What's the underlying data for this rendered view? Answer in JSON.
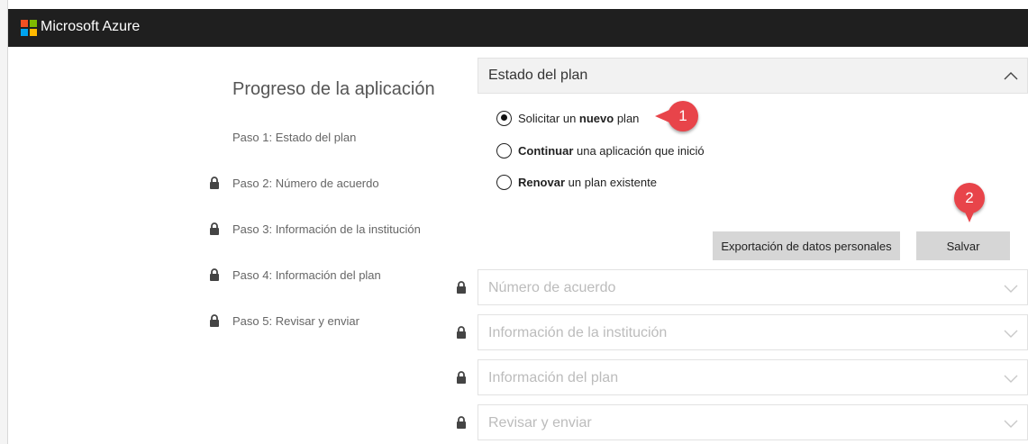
{
  "app": {
    "brand": "Microsoft Azure"
  },
  "progress": {
    "title": "Progreso de la aplicación",
    "steps": [
      {
        "label": "Paso 1: Estado del plan",
        "locked": false
      },
      {
        "label": "Paso 2: Número de acuerdo",
        "locked": true
      },
      {
        "label": "Paso 3: Información de la institución",
        "locked": true
      },
      {
        "label": "Paso 4: Información del plan",
        "locked": true
      },
      {
        "label": "Paso 5: Revisar y enviar",
        "locked": true
      }
    ]
  },
  "plan_status": {
    "title": "Estado del plan",
    "options": [
      {
        "pre": "Solicitar un ",
        "bold": "nuevo",
        "post": " plan",
        "checked": true
      },
      {
        "pre": "",
        "bold": "Continuar",
        "post": " una aplicación que inició",
        "checked": false
      },
      {
        "pre": "",
        "bold": "Renovar",
        "post": " un plan existente",
        "checked": false
      }
    ],
    "export_label": "Exportación de datos personales",
    "save_label": "Salvar"
  },
  "callouts": {
    "one": "1",
    "two": "2"
  },
  "sections": [
    {
      "title": "Número de acuerdo"
    },
    {
      "title": "Información de la institución"
    },
    {
      "title": "Información del plan"
    },
    {
      "title": "Revisar y enviar"
    }
  ],
  "colors": {
    "topbar": "#1f1f1f",
    "callout": "#e8444a",
    "button": "#d6d6d6"
  }
}
